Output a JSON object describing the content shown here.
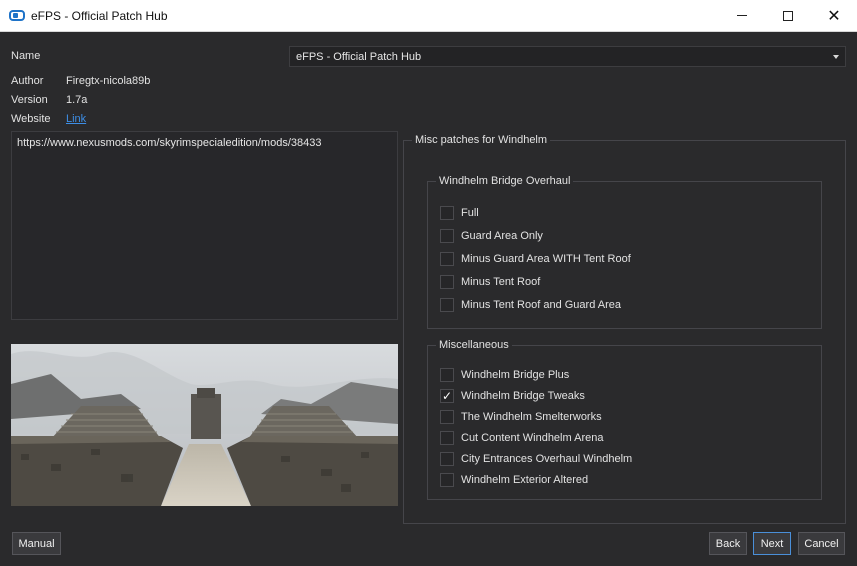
{
  "window": {
    "title": "eFPS - Official Patch Hub"
  },
  "header": {
    "name_label": "Name",
    "name_value": "eFPS - Official Patch Hub",
    "author_label": "Author",
    "author_value": "Firegtx-nicola89b",
    "version_label": "Version",
    "version_value": "1.7a",
    "website_label": "Website",
    "website_link": "Link"
  },
  "description": {
    "text": "https://www.nexusmods.com/skyrimspecialedition/mods/38433"
  },
  "options": {
    "title": "Misc patches for Windhelm",
    "groups": [
      {
        "title": "Windhelm Bridge Overhaul",
        "items": [
          {
            "label": "Full",
            "checked": false
          },
          {
            "label": "Guard Area Only",
            "checked": false
          },
          {
            "label": "Minus Guard Area WITH Tent Roof",
            "checked": false
          },
          {
            "label": "Minus Tent Roof",
            "checked": false
          },
          {
            "label": "Minus Tent Roof and Guard Area",
            "checked": false
          }
        ]
      },
      {
        "title": "Miscellaneous",
        "items": [
          {
            "label": "Windhelm Bridge Plus",
            "checked": false
          },
          {
            "label": "Windhelm Bridge Tweaks",
            "checked": true
          },
          {
            "label": "The Windhelm Smelterworks",
            "checked": false
          },
          {
            "label": "Cut Content Windhelm Arena",
            "checked": false
          },
          {
            "label": "City Entrances Overhaul Windhelm",
            "checked": false
          },
          {
            "label": "Windhelm Exterior Altered",
            "checked": false
          }
        ]
      }
    ]
  },
  "footer": {
    "manual": "Manual",
    "back": "Back",
    "next": "Next",
    "cancel": "Cancel"
  },
  "check_glyph": "✓",
  "colors": {
    "background": "#2a2a2c",
    "link": "#3d8ee6",
    "focus": "#4a8fd9"
  }
}
